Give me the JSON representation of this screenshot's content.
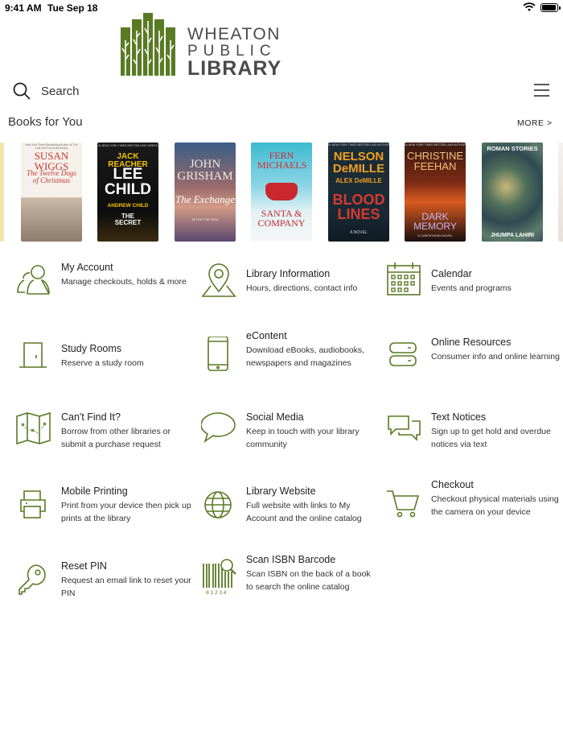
{
  "status_bar": {
    "time": "9:41 AM",
    "date": "Tue Sep 18"
  },
  "logo": {
    "line1": "WHEATON",
    "line2": "PUBLIC",
    "line3": "LIBRARY"
  },
  "search": {
    "label": "Search"
  },
  "books_section": {
    "title": "Books for You",
    "more": "MORE >"
  },
  "books": [
    {
      "author": "SUSAN WIGGS",
      "title": "The Twelve Dogs of Christmas",
      "top": "New York Times Bestselling Author of The Lost and Found Bookshop"
    },
    {
      "author": "LEE CHILD",
      "title": "THE SECRET",
      "series": "JACK REACHER",
      "coauthor": "ANDREW CHILD",
      "top": "#1 NEW YORK TIMES BESTSELLING SERIES"
    },
    {
      "author": "JOHN GRISHAM",
      "title": "The Exchange",
      "sub": "AFTER THE FIRM"
    },
    {
      "author": "FERN MICHAELS",
      "title": "SANTA & COMPANY"
    },
    {
      "author": "NELSON DeMILLE",
      "coauthor": "ALEX DeMILLE",
      "title": "BLOOD LINES",
      "sub": "A NOVEL",
      "top": "#1 NEW YORK TIMES BESTSELLING AUTHOR"
    },
    {
      "author": "CHRISTINE FEEHAN",
      "title": "DARK MEMORY",
      "sub": "A CARPATHIAN NOVEL",
      "top": "#1 NEW YORK TIMES BESTSELLING AUTHOR"
    },
    {
      "author": "JHUMPA LAHIRI",
      "title": "ROMAN STORIES"
    }
  ],
  "menu": [
    {
      "title": "My Account",
      "desc": "Manage checkouts, holds & more",
      "icon": "users-icon"
    },
    {
      "title": "Library Information",
      "desc": "Hours, directions, contact info",
      "icon": "map-pin-icon"
    },
    {
      "title": "Calendar",
      "desc": "Events and programs",
      "icon": "calendar-icon"
    },
    {
      "title": "Study Rooms",
      "desc": "Reserve a study room",
      "icon": "door-icon"
    },
    {
      "title": "eContent",
      "desc": "Download eBooks, audiobooks, newspapers and magazines",
      "icon": "tablet-icon"
    },
    {
      "title": "Online Resources",
      "desc": "Consumer info and online learning",
      "icon": "server-icon"
    },
    {
      "title": "Can't Find It?",
      "desc": "Borrow from other libraries or submit a purchase request",
      "icon": "map-icon"
    },
    {
      "title": "Social Media",
      "desc": "Keep in touch with your library community",
      "icon": "chat-bubble-icon"
    },
    {
      "title": "Text Notices",
      "desc": "Sign up to get hold and overdue notices via text",
      "icon": "chat-bubbles-icon"
    },
    {
      "title": "Mobile Printing",
      "desc": "Print from your device then pick up prints at the library",
      "icon": "printer-icon"
    },
    {
      "title": "Library Website",
      "desc": "Full website with links to My Account and the online catalog",
      "icon": "globe-icon"
    },
    {
      "title": "Checkout",
      "desc": "Checkout physical materials using the camera on your device",
      "icon": "cart-icon"
    },
    {
      "title": "Reset PIN",
      "desc": "Request an email link to reset your PIN",
      "icon": "key-icon"
    },
    {
      "title": "Scan ISBN Barcode",
      "desc": "Scan ISBN on the back of a book to search the online catalog",
      "icon": "barcode-icon",
      "barcode_digits": "01234"
    }
  ],
  "colors": {
    "accent": "#5a7a24"
  }
}
